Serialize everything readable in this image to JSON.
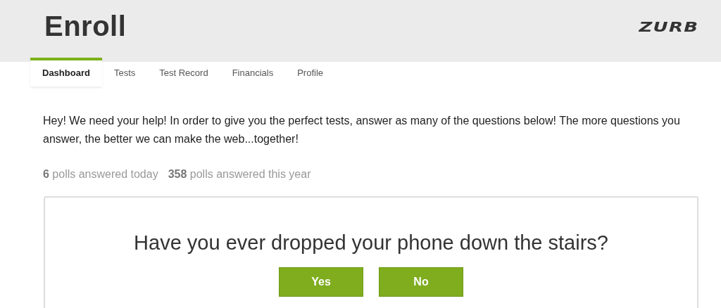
{
  "header": {
    "title": "Enroll",
    "logo": "ZURB"
  },
  "tabs": [
    {
      "label": "Dashboard",
      "selected": true
    },
    {
      "label": "Tests",
      "selected": false
    },
    {
      "label": "Test Record",
      "selected": false
    },
    {
      "label": "Financials",
      "selected": false
    },
    {
      "label": "Profile",
      "selected": false
    }
  ],
  "intro": "Hey! We need your help! In order to give you the perfect tests, answer as many of the questions below! The more questions you answer, the better we can make the web...together!",
  "stats": [
    "**6** polls answered today",
    "**358** polls answered this year"
  ],
  "poll": {
    "question": "Have you ever dropped your phone down the stairs?",
    "answers": [
      "Yes",
      "No"
    ]
  }
}
